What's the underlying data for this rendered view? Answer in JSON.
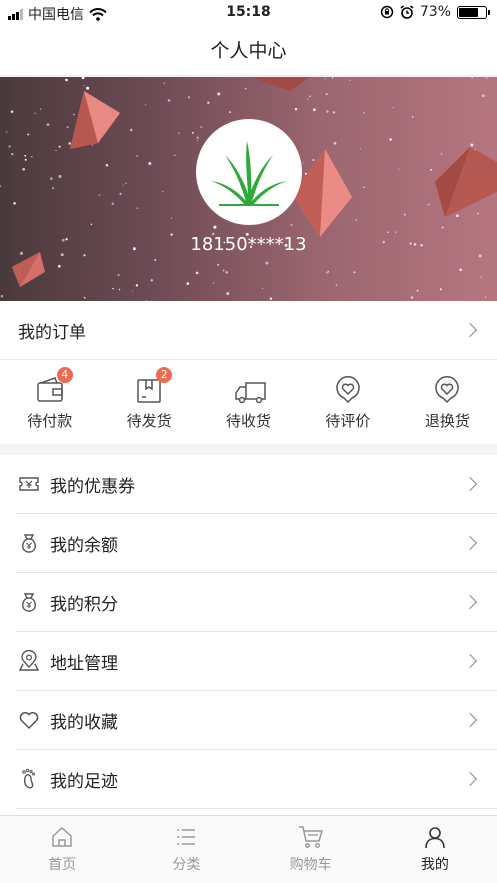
{
  "status_bar": {
    "carrier": "中国电信",
    "time": "15:18",
    "battery": "73%",
    "battery_level": 0.73
  },
  "nav": {
    "title": "个人中心"
  },
  "profile": {
    "phone": "18150****13"
  },
  "orders": {
    "title": "我的订单",
    "items": [
      {
        "label": "待付款",
        "badge": "4",
        "icon": "wallet-icon"
      },
      {
        "label": "待发货",
        "badge": "2",
        "icon": "package-icon"
      },
      {
        "label": "待收货",
        "badge": "",
        "icon": "truck-icon"
      },
      {
        "label": "待评价",
        "badge": "",
        "icon": "heart-chat-icon"
      },
      {
        "label": "退换货",
        "badge": "",
        "icon": "heart-chat-icon"
      }
    ]
  },
  "menu": {
    "items": [
      {
        "label": "我的优惠券",
        "icon": "coupon-icon"
      },
      {
        "label": "我的余额",
        "icon": "money-bag-icon"
      },
      {
        "label": "我的积分",
        "icon": "money-bag-icon"
      },
      {
        "label": "地址管理",
        "icon": "location-icon"
      },
      {
        "label": "我的收藏",
        "icon": "heart-icon"
      },
      {
        "label": "我的足迹",
        "icon": "footprint-icon"
      }
    ]
  },
  "tabbar": {
    "items": [
      {
        "label": "首页",
        "icon": "home-icon",
        "active": false
      },
      {
        "label": "分类",
        "icon": "list-icon",
        "active": false
      },
      {
        "label": "购物车",
        "icon": "cart-icon",
        "active": false
      },
      {
        "label": "我的",
        "icon": "user-icon",
        "active": true
      }
    ]
  }
}
